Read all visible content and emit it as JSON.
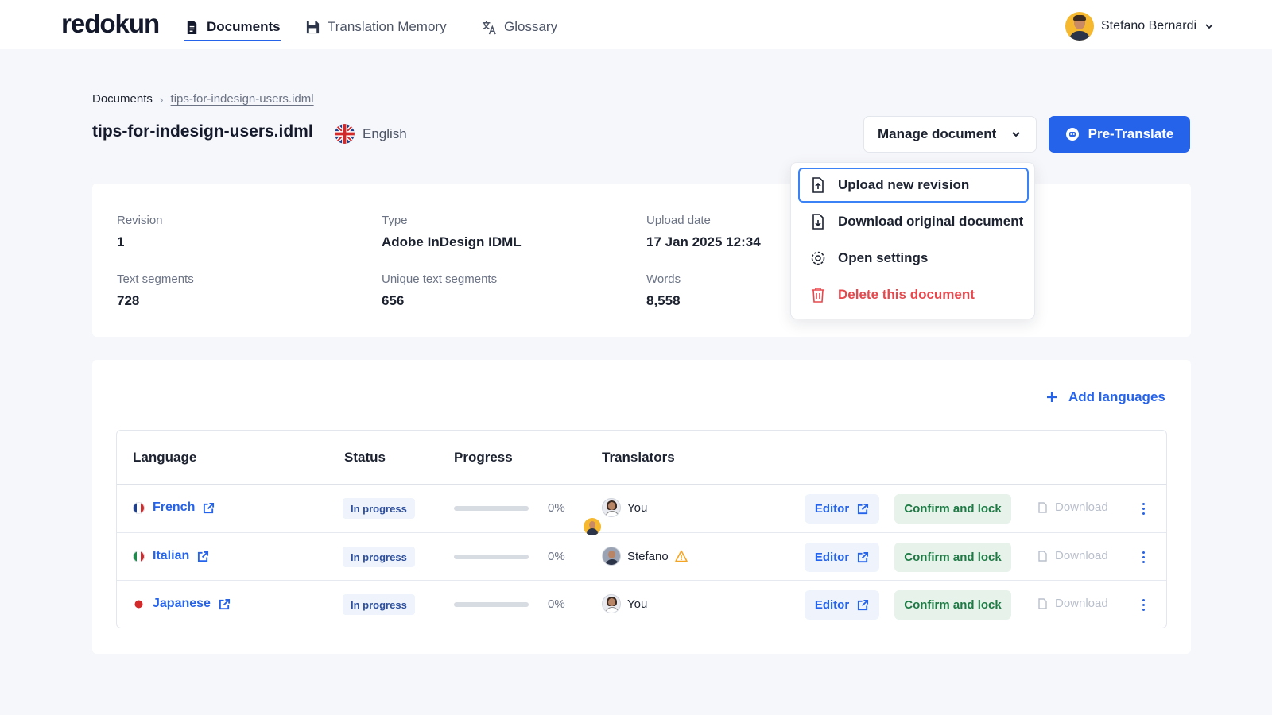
{
  "app": {
    "logo": "redokun"
  },
  "nav": {
    "tabs": [
      {
        "label": "Documents",
        "active": true
      },
      {
        "label": "Translation Memory",
        "active": false
      },
      {
        "label": "Glossary",
        "active": false
      }
    ]
  },
  "user": {
    "name": "Stefano Bernardi"
  },
  "breadcrumb": {
    "root": "Documents",
    "current": "tips-for-indesign-users.idml"
  },
  "document": {
    "title": "tips-for-indesign-users.idml",
    "source_language": "English",
    "fields": {
      "revision": {
        "label": "Revision",
        "value": "1"
      },
      "type": {
        "label": "Type",
        "value": "Adobe InDesign IDML"
      },
      "upload_date": {
        "label": "Upload date",
        "value": "17 Jan 2025 12:34"
      },
      "text_segments": {
        "label": "Text segments",
        "value": "728"
      },
      "unique_segments": {
        "label": "Unique text segments",
        "value": "656"
      },
      "words": {
        "label": "Words",
        "value": "8,558"
      }
    }
  },
  "actions": {
    "manage_label": "Manage document",
    "pretranslate_label": "Pre-Translate"
  },
  "manage_menu": {
    "items": [
      {
        "label": "Upload new revision"
      },
      {
        "label": "Download original document"
      },
      {
        "label": "Open settings"
      },
      {
        "label": "Delete this document"
      }
    ]
  },
  "languages": {
    "add_label": "Add languages",
    "columns": [
      "Language",
      "Status",
      "Progress",
      "Translators"
    ],
    "rows": [
      {
        "language": "French",
        "status": "In progress",
        "progress": 0,
        "progress_label": "0%",
        "translator": "You",
        "editor": "Editor",
        "confirm": "Confirm and lock",
        "download": "Download"
      },
      {
        "language": "Italian",
        "status": "In progress",
        "progress": 0,
        "progress_label": "0%",
        "translator": "Stefano",
        "editor": "Editor",
        "confirm": "Confirm and lock",
        "download": "Download"
      },
      {
        "language": "Japanese",
        "status": "In progress",
        "progress": 0,
        "progress_label": "0%",
        "translator": "You",
        "editor": "Editor",
        "confirm": "Confirm and lock",
        "download": "Download"
      }
    ]
  },
  "colors": {
    "accent": "#2563eb",
    "danger": "#e5484d",
    "success_text": "#1e7a44",
    "warning": "#f5a524"
  }
}
